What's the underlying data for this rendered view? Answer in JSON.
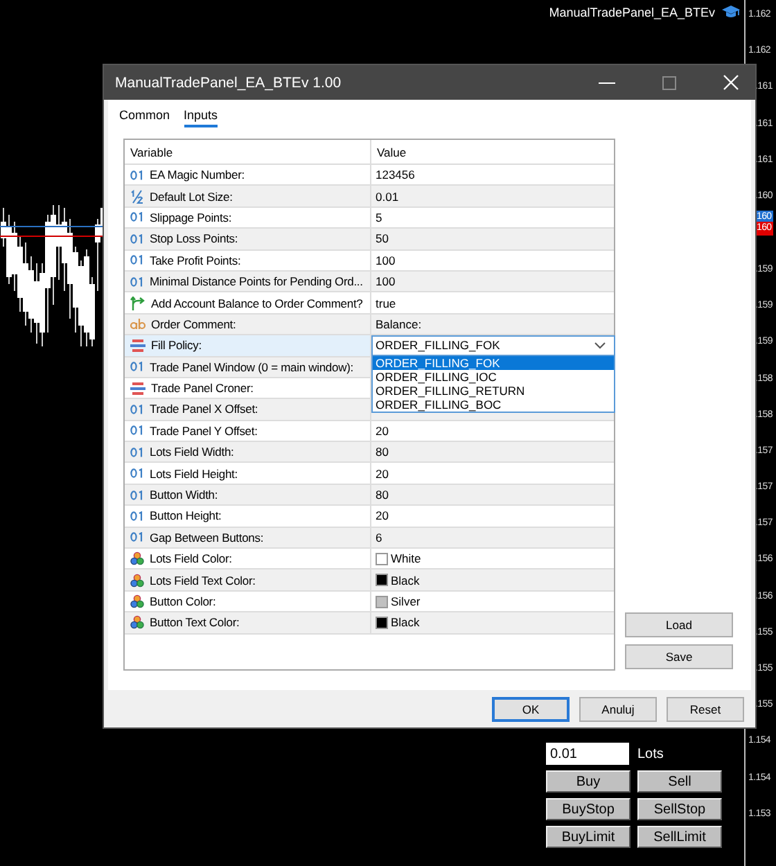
{
  "chart": {
    "expert_label": "ManualTradePanel_EA_BTEv",
    "price_labels": [
      {
        "text": "1.162",
        "inset": false
      },
      {
        "text": "1.162",
        "inset": false
      },
      {
        "text": ".161",
        "inset": true
      },
      {
        "text": ".161",
        "inset": true
      },
      {
        "text": ".161",
        "inset": true
      },
      {
        "text": ".160",
        "inset": true
      },
      {
        "text": "160",
        "inset": true,
        "color": "#1f6fd0"
      },
      {
        "text": "160",
        "inset": true,
        "color": "#e00000"
      },
      {
        "text": ".159",
        "inset": true
      },
      {
        "text": ".159",
        "inset": true
      },
      {
        "text": ".159",
        "inset": true
      },
      {
        "text": ".158",
        "inset": true
      },
      {
        "text": ".158",
        "inset": true
      },
      {
        "text": ".157",
        "inset": true
      },
      {
        "text": ".157",
        "inset": true
      },
      {
        "text": ".157",
        "inset": true
      },
      {
        "text": ".156",
        "inset": true
      },
      {
        "text": ".156",
        "inset": true
      },
      {
        "text": ".155",
        "inset": true
      },
      {
        "text": ".155",
        "inset": true
      },
      {
        "text": ".155",
        "inset": true
      },
      {
        "text": "1.154",
        "inset": false
      },
      {
        "text": "1.154",
        "inset": false
      },
      {
        "text": "1.153",
        "inset": false
      }
    ]
  },
  "window": {
    "title": "ManualTradePanel_EA_BTEv 1.00"
  },
  "tabs": [
    {
      "label": "Common",
      "selected": false
    },
    {
      "label": "Inputs",
      "selected": true
    }
  ],
  "table": {
    "columns": [
      "Variable",
      "Value"
    ],
    "rows": [
      {
        "kind": "int",
        "name": "EA Magic Number:",
        "value": "123456",
        "selected": false
      },
      {
        "kind": "double",
        "name": "Default Lot Size:",
        "value": "0.01",
        "selected": false
      },
      {
        "kind": "int",
        "name": "Slippage Points:",
        "value": "5",
        "selected": false
      },
      {
        "kind": "int",
        "name": "Stop Loss Points:",
        "value": "50",
        "selected": false
      },
      {
        "kind": "int",
        "name": "Take Profit Points:",
        "value": "100",
        "selected": false
      },
      {
        "kind": "int",
        "name": "Minimal Distance Points for Pending Ord...",
        "value": "100",
        "selected": false
      },
      {
        "kind": "bool",
        "name": "Add Account Balance to Order Comment?",
        "value": "true",
        "selected": false
      },
      {
        "kind": "string",
        "name": "Order Comment:",
        "value": "Balance:",
        "selected": false
      },
      {
        "kind": "enum",
        "name": "Fill Policy:",
        "value": "ORDER_FILLING_FOK",
        "selected": true,
        "dropdown": {
          "expanded": true,
          "options": [
            {
              "label": "ORDER_FILLING_FOK",
              "selected": true
            },
            {
              "label": "ORDER_FILLING_IOC",
              "selected": false
            },
            {
              "label": "ORDER_FILLING_RETURN",
              "selected": false
            },
            {
              "label": "ORDER_FILLING_BOC",
              "selected": false
            }
          ]
        }
      },
      {
        "kind": "int",
        "name": "Trade Panel Window (0 = main window):",
        "selected": false
      },
      {
        "kind": "enum",
        "name": "Trade Panel Croner:",
        "selected": false
      },
      {
        "kind": "int",
        "name": "Trade Panel X Offset:",
        "selected": false
      },
      {
        "kind": "int",
        "name": "Trade Panel Y Offset:",
        "value": "20",
        "selected": false
      },
      {
        "kind": "int",
        "name": "Lots Field Width:",
        "value": "80",
        "selected": false
      },
      {
        "kind": "int",
        "name": "Lots Field Height:",
        "value": "20",
        "selected": false
      },
      {
        "kind": "int",
        "name": "Button Width:",
        "value": "80",
        "selected": false
      },
      {
        "kind": "int",
        "name": "Button Height:",
        "value": "20",
        "selected": false
      },
      {
        "kind": "int",
        "name": "Gap Between Buttons:",
        "value": "6",
        "selected": false
      },
      {
        "kind": "color",
        "name": "Lots Field Color:",
        "value": "White",
        "color": "#ffffff",
        "selected": false
      },
      {
        "kind": "color",
        "name": "Lots Field Text Color:",
        "value": "Black",
        "color": "#000000",
        "selected": false
      },
      {
        "kind": "color",
        "name": "Button Color:",
        "value": "Silver",
        "color": "#c0c0c0",
        "selected": false
      },
      {
        "kind": "color",
        "name": "Button Text Color:",
        "value": "Black",
        "color": "#000000",
        "selected": false
      }
    ]
  },
  "side_buttons": [
    "Load",
    "Save"
  ],
  "footer_buttons": [
    {
      "label": "OK",
      "default": true
    },
    {
      "label": "Anuluj",
      "default": false
    },
    {
      "label": "Reset",
      "default": false
    }
  ],
  "trade_panel": {
    "lots_value": "0.01",
    "lots_label": "Lots",
    "buttons": [
      "Buy",
      "Sell",
      "BuyStop",
      "SellStop",
      "BuyLimit",
      "SellLimit"
    ]
  }
}
